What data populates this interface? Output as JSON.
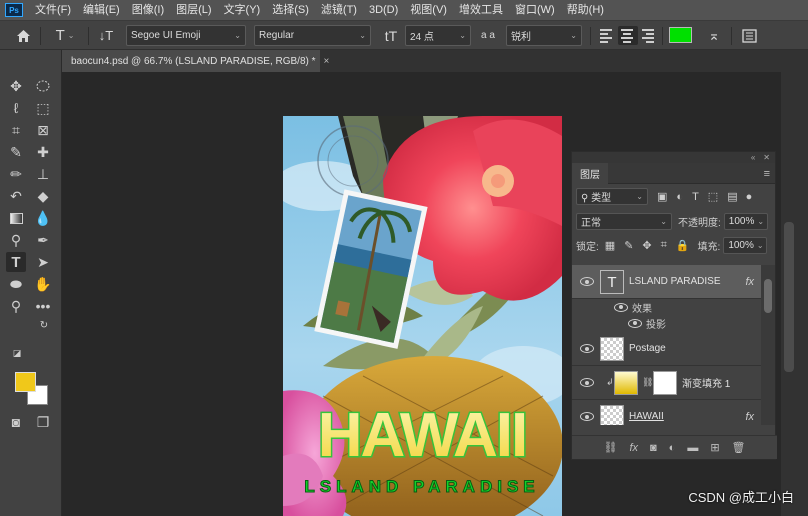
{
  "app": {
    "logo": "Ps"
  },
  "menu": [
    "文件(F)",
    "编辑(E)",
    "图像(I)",
    "图层(L)",
    "文字(Y)",
    "选择(S)",
    "滤镜(T)",
    "3D(D)",
    "视图(V)",
    "增效工具",
    "窗口(W)",
    "帮助(H)"
  ],
  "options": {
    "font_family": "Segoe UI Emoji",
    "font_style": "Regular",
    "font_size": "24 点",
    "antialias_label": "a a",
    "antialias": "锐利",
    "text_color": "#00e000"
  },
  "document_tab": {
    "title": "baocun4.psd @ 66.7% (LSLAND PARADISE, RGB/8) *",
    "close": "×"
  },
  "colors": {
    "foreground": "#f0c81a",
    "background": "#ffffff"
  },
  "artwork": {
    "title": "HAWAII",
    "subtitle": "LSLAND PARADISE"
  },
  "layers_panel": {
    "tab": "图层",
    "filter_type": "类型",
    "blend_mode": "正常",
    "opacity_label": "不透明度:",
    "opacity": "100%",
    "lock_label": "锁定:",
    "fill_label": "填充:",
    "fill": "100%",
    "layers": [
      {
        "name": "LSLAND PARADISE",
        "fx": "fx",
        "selected": true
      },
      {
        "name": "Postage"
      },
      {
        "name": "渐变填充 1"
      },
      {
        "name": "HAWAII",
        "fx": "fx"
      }
    ],
    "effects_label": "效果",
    "drop_shadow_label": "投影"
  },
  "watermark": "CSDN @成工小白"
}
